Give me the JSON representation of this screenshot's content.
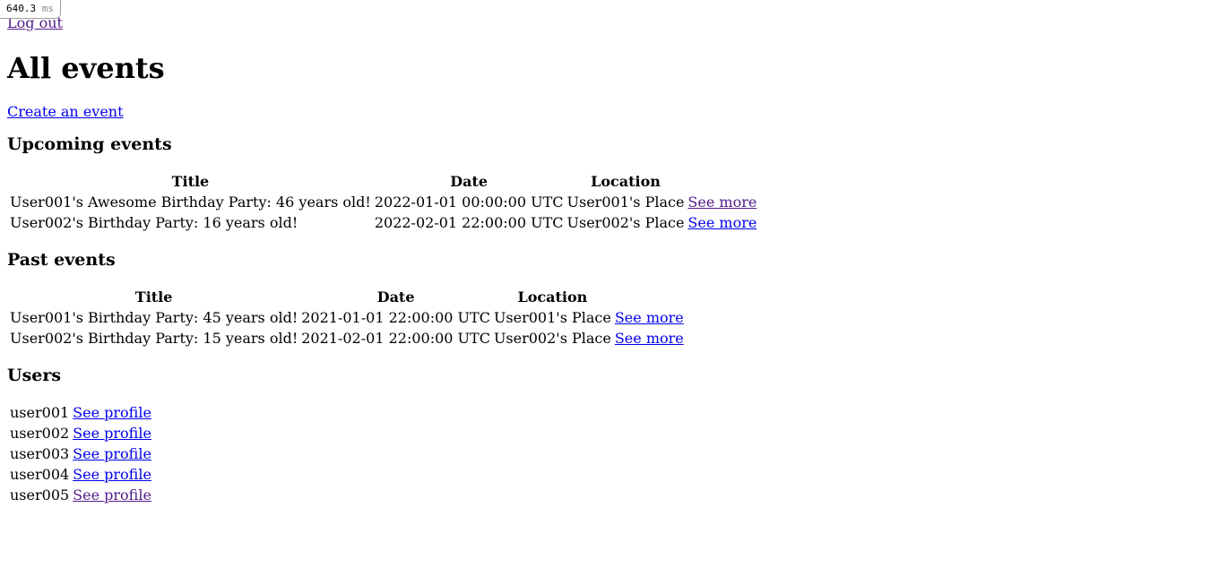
{
  "timing": {
    "value": "640.3",
    "unit": "ms"
  },
  "nav": {
    "logout_label": "Log out"
  },
  "page": {
    "title": "All events",
    "create_event_label": "Create an event"
  },
  "upcoming": {
    "heading": "Upcoming events",
    "columns": [
      "Title",
      "Date",
      "Location"
    ],
    "rows": [
      {
        "title": "User001's Awesome Birthday Party: 46 years old!",
        "date": "2022-01-01 00:00:00 UTC",
        "location": "User001's Place",
        "link": "See more"
      },
      {
        "title": "User002's Birthday Party: 16 years old!",
        "date": "2022-02-01 22:00:00 UTC",
        "location": "User002's Place",
        "link": "See more"
      }
    ]
  },
  "past": {
    "heading": "Past events",
    "columns": [
      "Title",
      "Date",
      "Location"
    ],
    "rows": [
      {
        "title": "User001's Birthday Party: 45 years old!",
        "date": "2021-01-01 22:00:00 UTC",
        "location": "User001's Place",
        "link": "See more"
      },
      {
        "title": "User002's Birthday Party: 15 years old!",
        "date": "2021-02-01 22:00:00 UTC",
        "location": "User002's Place",
        "link": "See more"
      }
    ]
  },
  "users": {
    "heading": "Users",
    "rows": [
      {
        "name": "user001",
        "link": "See profile"
      },
      {
        "name": "user002",
        "link": "See profile"
      },
      {
        "name": "user003",
        "link": "See profile"
      },
      {
        "name": "user004",
        "link": "See profile"
      },
      {
        "name": "user005",
        "link": "See profile"
      }
    ]
  },
  "colors": {
    "link": "#0000ee",
    "visited_link": "#551a8b",
    "text": "#000000",
    "background": "#ffffff"
  }
}
